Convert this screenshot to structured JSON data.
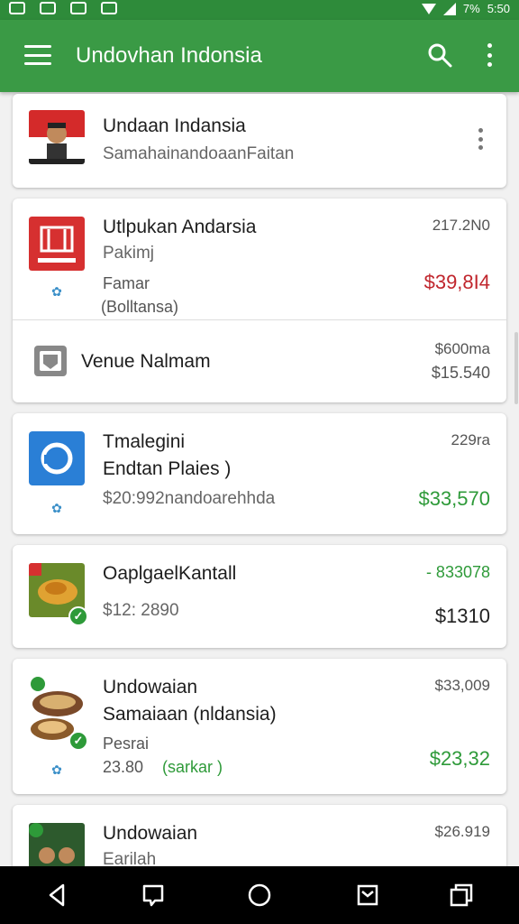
{
  "status": {
    "battery_text": "7%",
    "time": "5:50"
  },
  "appbar": {
    "title": "Undovhan Indonsia"
  },
  "cards": [
    {
      "title": "Undaan Indansia",
      "subtitle": "SamahainandoaanFaitan"
    },
    {
      "title": "Utlpukan Andarsia",
      "subtitle": "Pakimj",
      "line3": "Famar",
      "line4": "(Bolltansa)",
      "right_top": "217.2N0",
      "amount": "$39,8I4",
      "sub_row": {
        "label": "Venue Nalmam",
        "right_top": "$600ma",
        "right_bottom": "$15.540"
      }
    },
    {
      "title": "Tmalegini",
      "subtitle": "Endtan Plaies )",
      "line3": "$20:992nandoarehhda",
      "right_top": "229ra",
      "amount": "$33,570"
    },
    {
      "title": "OaplgaelKantall",
      "subtitle": "$12: 2890",
      "right_top": "- 833078",
      "amount": "$1310"
    },
    {
      "title": "Undowaian",
      "subtitle": "Samaiaan (nldansia)",
      "line3": "Pesrai",
      "line4": "23.80",
      "line4_tag": "(sarkar )",
      "right_top": "$33,009",
      "amount": "$23,32"
    },
    {
      "title": "Undowaian",
      "subtitle": "Earilah",
      "right_top": "$26.919"
    }
  ],
  "colors": {
    "brand": "#3a9a45",
    "statusbar": "#2e8b3a",
    "positive": "#2e9a39",
    "negative": "#c0262d"
  }
}
